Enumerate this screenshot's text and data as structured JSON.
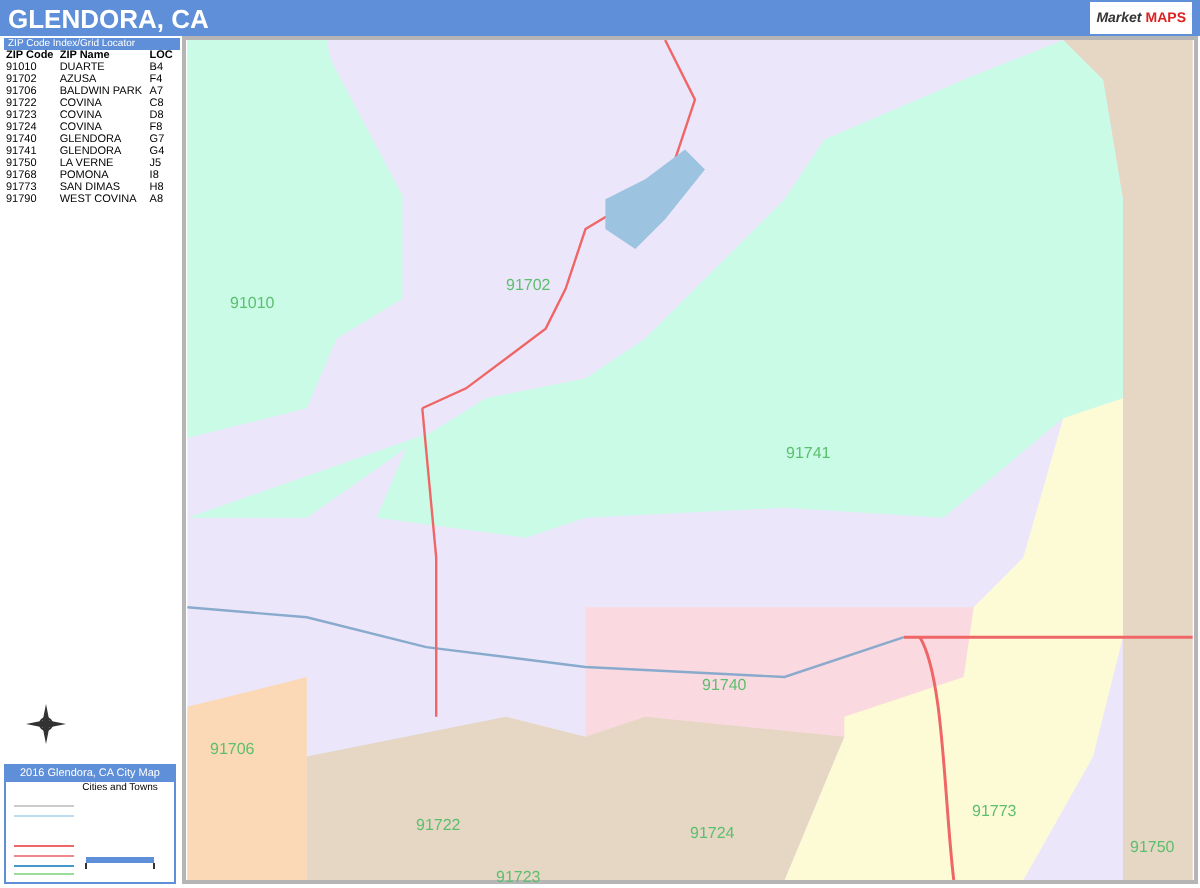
{
  "header": {
    "title": "GLENDORA, CA"
  },
  "logo": {
    "word_1": "Market",
    "word_2": "MAPS"
  },
  "zip_index": {
    "title": "ZIP Code Index/Grid Locator",
    "columns": [
      "ZIP Code",
      "ZIP Name",
      "LOC"
    ],
    "rows": [
      [
        "91010",
        "DUARTE",
        "B4"
      ],
      [
        "91702",
        "AZUSA",
        "F4"
      ],
      [
        "91706",
        "BALDWIN PARK",
        "A7"
      ],
      [
        "91722",
        "COVINA",
        "C8"
      ],
      [
        "91723",
        "COVINA",
        "D8"
      ],
      [
        "91724",
        "COVINA",
        "F8"
      ],
      [
        "91740",
        "GLENDORA",
        "G7"
      ],
      [
        "91741",
        "GLENDORA",
        "G4"
      ],
      [
        "91750",
        "LA VERNE",
        "J5"
      ],
      [
        "91768",
        "POMONA",
        "I8"
      ],
      [
        "91773",
        "SAN DIMAS",
        "H8"
      ],
      [
        "91790",
        "WEST COVINA",
        "A8"
      ]
    ]
  },
  "map": {
    "zip_labels": [
      "91010",
      "91702",
      "91741",
      "91740",
      "91706",
      "91722",
      "91724",
      "91723",
      "91773",
      "91750"
    ]
  },
  "legend": {
    "title": "2016 Glendora, CA City Map",
    "subtitle": "Cities and Towns"
  }
}
